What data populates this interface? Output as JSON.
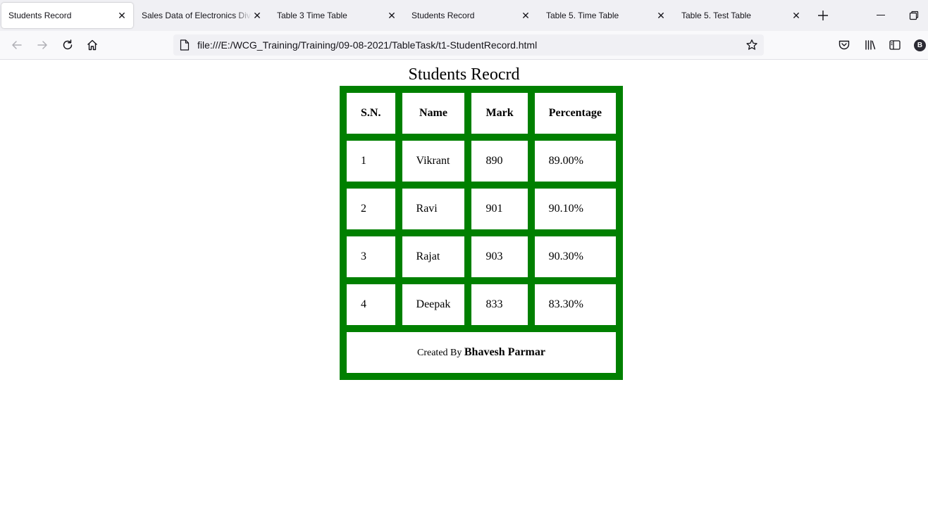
{
  "browser": {
    "tabs": [
      {
        "title": "Students Record",
        "active": true
      },
      {
        "title": "Sales Data of Electronics Division",
        "active": false
      },
      {
        "title": "Table 3 Time Table",
        "active": false
      },
      {
        "title": "Students Record",
        "active": false
      },
      {
        "title": "Table 5. Time Table",
        "active": false
      },
      {
        "title": "Table 5. Test Table",
        "active": false
      }
    ],
    "url": "file:///E:/WCG_Training/Training/09-08-2021/TableTask/t1-StudentRecord.html",
    "profile_initial": "B"
  },
  "page": {
    "title": "Students Reocrd",
    "table": {
      "headers": [
        "S.N.",
        "Name",
        "Mark",
        "Percentage"
      ],
      "rows": [
        [
          "1",
          "Vikrant",
          "890",
          "89.00%"
        ],
        [
          "2",
          "Ravi",
          "901",
          "90.10%"
        ],
        [
          "3",
          "Rajat",
          "903",
          "90.30%"
        ],
        [
          "4",
          "Deepak",
          "833",
          "83.30%"
        ]
      ],
      "footer_prefix": "Created By",
      "footer_author": "Bhavesh Parmar"
    },
    "table_color": "#008000"
  }
}
